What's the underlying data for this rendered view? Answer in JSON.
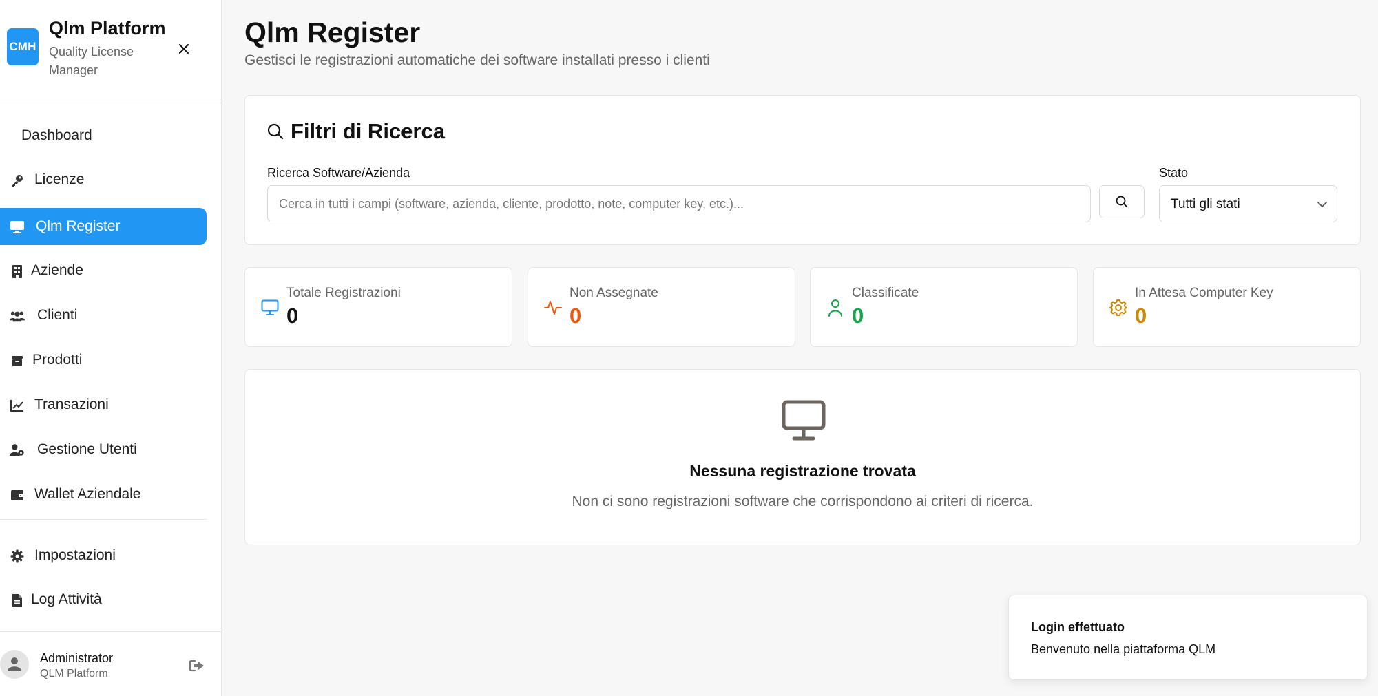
{
  "sidebar": {
    "brand": {
      "logo_text": "CMH",
      "title": "Qlm Platform",
      "subtitle": "Quality License Manager",
      "logo_color": "#2196f3"
    },
    "items": [
      {
        "label": "Dashboard",
        "icon": "none"
      },
      {
        "label": "Licenze",
        "icon": "key-icon"
      },
      {
        "label": "Qlm Register",
        "icon": "monitor-icon",
        "active": true
      },
      {
        "label": "Aziende",
        "icon": "building-icon"
      },
      {
        "label": "Clienti",
        "icon": "users-icon"
      },
      {
        "label": "Prodotti",
        "icon": "box-icon"
      },
      {
        "label": "Transazioni",
        "icon": "chart-line-icon"
      },
      {
        "label": "Gestione Utenti",
        "icon": "user-gear-icon"
      },
      {
        "label": "Wallet Aziendale",
        "icon": "wallet-icon"
      }
    ],
    "bottom_items": [
      {
        "label": "Impostazioni",
        "icon": "gear-icon"
      },
      {
        "label": "Log Attività",
        "icon": "file-icon"
      }
    ],
    "user": {
      "name": "Administrator",
      "role": "QLM Platform"
    }
  },
  "header": {
    "title": "Qlm Register",
    "subtitle": "Gestisci le registrazioni automatiche dei software installati presso i clienti"
  },
  "filters": {
    "title": "Filtri di Ricerca",
    "search_label": "Ricerca Software/Azienda",
    "search_placeholder": "Cerca in tutti i campi (software, azienda, cliente, prodotto, note, computer key, etc.)...",
    "search_value": "",
    "status_label": "Stato",
    "status_value": "Tutti gli stati"
  },
  "stats": [
    {
      "label": "Totale Registrazioni",
      "value": "0",
      "color": "#111111",
      "icon_color": "#2196f3",
      "icon": "monitor-icon"
    },
    {
      "label": "Non Assegnate",
      "value": "0",
      "color": "#ea580c",
      "icon_color": "#ea580c",
      "icon": "activity-icon"
    },
    {
      "label": "Classificate",
      "value": "0",
      "color": "#16a34a",
      "icon_color": "#16a34a",
      "icon": "user-icon"
    },
    {
      "label": "In Attesa Computer Key",
      "value": "0",
      "color": "#ca8a04",
      "icon_color": "#ca8a04",
      "icon": "gear-icon"
    }
  ],
  "empty": {
    "title": "Nessuna registrazione trovata",
    "description": "Non ci sono registrazioni software che corrispondono ai criteri di ricerca."
  },
  "toast": {
    "title": "Login effettuato",
    "description": "Benvenuto nella piattaforma QLM"
  }
}
